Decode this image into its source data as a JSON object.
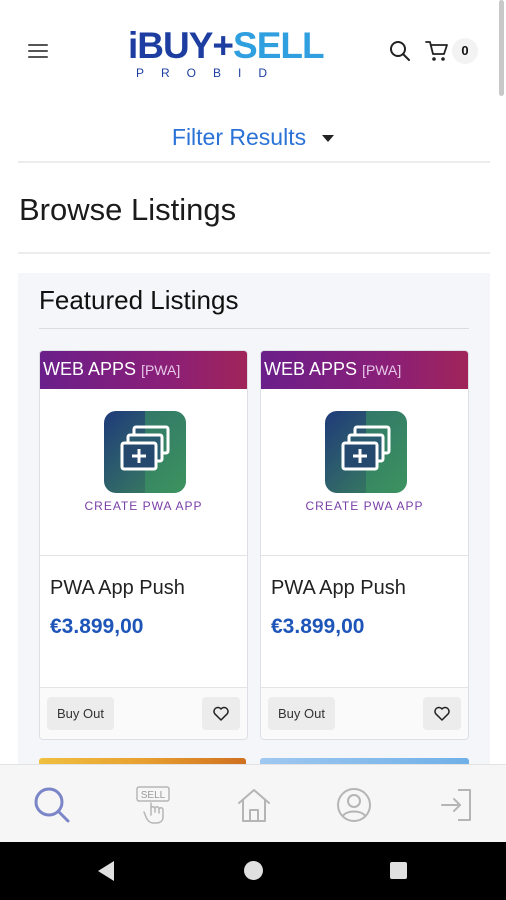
{
  "header": {
    "logo": {
      "i": "i",
      "buy": "BUY",
      "plus": "+",
      "sell": "SELL",
      "tagline": "PROBID"
    },
    "cart_count": "0"
  },
  "filter": {
    "label": "Filter Results"
  },
  "page_title": "Browse Listings",
  "featured": {
    "title": "Featured Listings",
    "cards": [
      {
        "banner": "WEB APPS",
        "banner_sub": "[PWA]",
        "image_caption": "CREATE PWA APP",
        "title": "PWA App Push",
        "price": "€3.899,00",
        "buyout_label": "Buy Out"
      },
      {
        "banner": "WEB APPS",
        "banner_sub": "[PWA]",
        "image_caption": "CREATE PWA APP",
        "title": "PWA App Push",
        "price": "€3.899,00",
        "buyout_label": "Buy Out"
      }
    ]
  },
  "bottom_nav": {
    "sell_icon_text": "SELL",
    "items": [
      "search-icon",
      "sell-icon",
      "home-icon",
      "account-icon",
      "login-icon"
    ]
  },
  "colors": {
    "accent_blue": "#2b72d6",
    "price_blue": "#1e55b8",
    "banner_purple": "#6a1f8a",
    "logo_navy": "#1d3ea0",
    "logo_sky": "#2f9fe0"
  }
}
